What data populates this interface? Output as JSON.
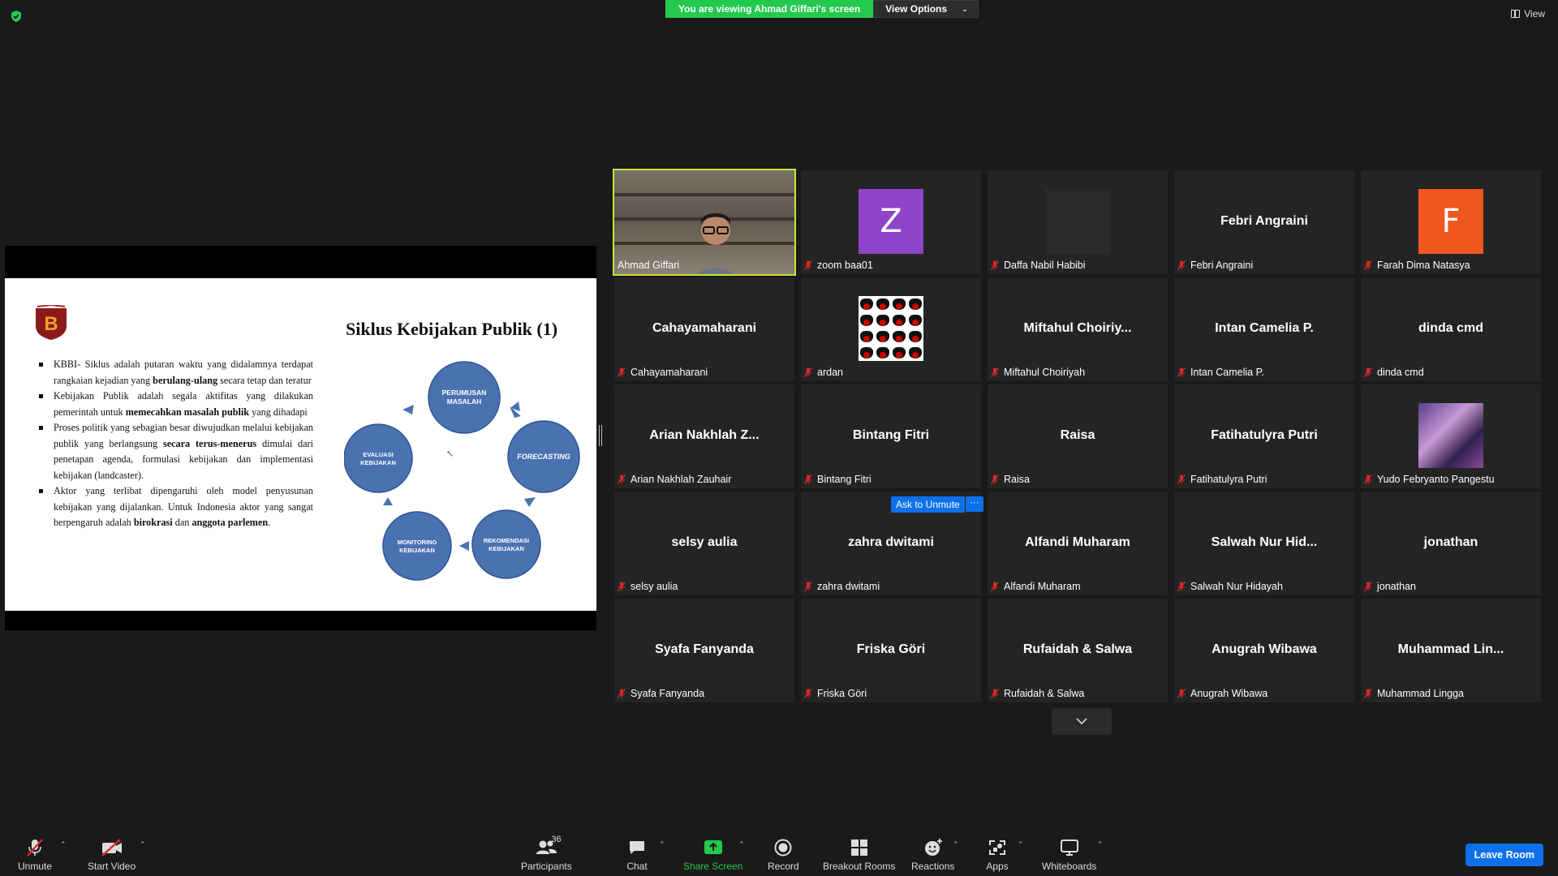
{
  "banner": {
    "viewing_text": "You are viewing Ahmad Giffari's screen",
    "options_label": "View Options"
  },
  "view_label": "View",
  "slide": {
    "title": "Siklus Kebijakan Publik (1)",
    "bullets": [
      {
        "pre": "KBBI- Siklus adalah putaran waktu yang didalamnya terdapat rangkaian kejadian yang ",
        "bold": "berulang-ulang",
        "post": " secara tetap dan teratur",
        "bold2": "",
        "post2": ""
      },
      {
        "pre": "Kebijakan Publik adalah segala aktifitas yang dilakukan pemerintah untuk ",
        "bold": "memecahkan masalah publik",
        "post": " yang dihadapi",
        "bold2": "",
        "post2": ""
      },
      {
        "pre": "Proses politik yang sebagian besar diwujudkan melalui kebijakan publik yang berlangsung ",
        "bold": "secara terus-menerus",
        "post": " dimulai dari penetapan agenda, formulasi kebijakan dan implementasi kebijakan (landcaster).",
        "bold2": "",
        "post2": ""
      },
      {
        "pre": "Aktor yang terlibat dipengaruhi oleh model penyusunan kebijakan yang dijalankan. Untuk Indonesia aktor yang sangat berpengaruh adalah ",
        "bold": "birokrasi",
        "post": " dan ",
        "bold2": "anggota parlemen",
        "post2": "."
      }
    ],
    "cycle": {
      "n1a": "PERUMUSAN",
      "n1b": "MASALAH",
      "n2": "FORECASTING",
      "n3a": "REKOMENDASI",
      "n3b": "KEBIJAKAN",
      "n4a": "MONITORING",
      "n4b": "KEBIJAKAN",
      "n5a": "EVALUASI",
      "n5b": "KEBIJAKAN"
    }
  },
  "tiles": [
    {
      "label": "Ahmad Giffari",
      "big": "",
      "type": "video",
      "muted": false
    },
    {
      "label": "zoom baa01",
      "big": "",
      "type": "avatar",
      "letter": "Z",
      "color": "#8e44c8",
      "muted": true
    },
    {
      "label": "Daffa Nabil Habibi",
      "big": "",
      "type": "dark",
      "muted": true
    },
    {
      "label": "Febri Angraini",
      "big": "Febri Angraini",
      "type": "name",
      "muted": true
    },
    {
      "label": "Farah Dima Natasya",
      "big": "",
      "type": "avatar",
      "letter": "F",
      "color": "#f0561d",
      "muted": true
    },
    {
      "label": "Cahayamaharani",
      "big": "Cahayamaharani",
      "type": "name",
      "muted": true
    },
    {
      "label": "ardan",
      "big": "",
      "type": "tongue",
      "muted": true
    },
    {
      "label": "Miftahul Choiriyah",
      "big": "Miftahul  Choiriy...",
      "type": "name",
      "muted": true
    },
    {
      "label": "Intan Camelia P.",
      "big": "Intan Camelia P.",
      "type": "name",
      "muted": true
    },
    {
      "label": "dinda cmd",
      "big": "dinda cmd",
      "type": "name",
      "muted": true
    },
    {
      "label": "Arian Nakhlah Zauhair",
      "big": "Arian  Nakhlah  Z...",
      "type": "name",
      "muted": true
    },
    {
      "label": "Bintang Fitri",
      "big": "Bintang Fitri",
      "type": "name",
      "muted": true
    },
    {
      "label": "Raisa",
      "big": "Raisa",
      "type": "name",
      "muted": true
    },
    {
      "label": "Fatihatulyra Putri",
      "big": "Fatihatulyra Putri",
      "type": "name",
      "muted": true
    },
    {
      "label": "Yudo Febryanto Pangestu",
      "big": "",
      "type": "party",
      "muted": true
    },
    {
      "label": "selsy aulia",
      "big": "selsy aulia",
      "type": "name",
      "muted": true
    },
    {
      "label": "zahra dwitami",
      "big": "zahra dwitami",
      "type": "name",
      "muted": true
    },
    {
      "label": "Alfandi Muharam",
      "big": "Alfandi Muharam",
      "type": "name",
      "muted": true
    },
    {
      "label": "Salwah Nur Hidayah",
      "big": "Salwah  Nur  Hid...",
      "type": "name",
      "muted": true
    },
    {
      "label": "jonathan",
      "big": "jonathan",
      "type": "name",
      "muted": true
    },
    {
      "label": "Syafa Fanyanda",
      "big": "Syafa Fanyanda",
      "type": "name",
      "muted": true
    },
    {
      "label": "Friska Göri",
      "big": "Friska Göri",
      "type": "name",
      "muted": true
    },
    {
      "label": "Rufaidah & Salwa",
      "big": "Rufaidah & Salwa",
      "type": "name",
      "muted": true
    },
    {
      "label": "Anugrah Wibawa",
      "big": "Anugrah Wibawa",
      "type": "name",
      "muted": true
    },
    {
      "label": "Muhammad Lingga",
      "big": "Muhammad  Lin...",
      "type": "name",
      "muted": true
    }
  ],
  "hover": {
    "ask_unmute": "Ask to Unmute",
    "more": "···"
  },
  "toolbar": {
    "unmute": "Unmute",
    "start_video": "Start Video",
    "participants": "Participants",
    "participants_count": "36",
    "chat": "Chat",
    "share_screen": "Share Screen",
    "record": "Record",
    "breakout_rooms": "Breakout Rooms",
    "reactions": "Reactions",
    "apps": "Apps",
    "whiteboards": "Whiteboards",
    "leave": "Leave Room"
  },
  "colors": {
    "accent_green": "#22c94d",
    "active_speaker": "#c6e535",
    "blue": "#0e71eb",
    "muted_red": "#e02828"
  }
}
